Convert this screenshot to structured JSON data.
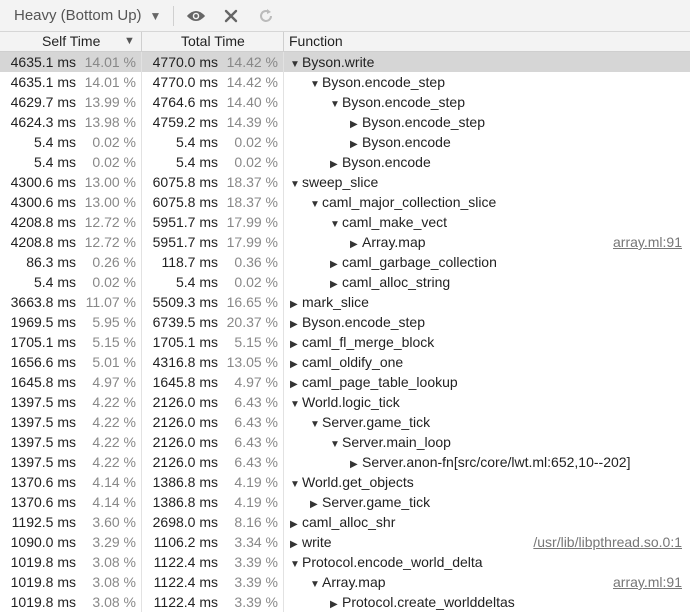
{
  "toolbar": {
    "view_label": "Heavy (Bottom Up)"
  },
  "columns": {
    "self": "Self Time",
    "total": "Total Time",
    "function": "Function"
  },
  "rows": [
    {
      "self_ms": "4635.1 ms",
      "self_pct": "14.01 %",
      "total_ms": "4770.0 ms",
      "total_pct": "14.42 %",
      "depth": 0,
      "arrow": "expanded",
      "name": "Byson.write",
      "src": "",
      "selected": true
    },
    {
      "self_ms": "4635.1 ms",
      "self_pct": "14.01 %",
      "total_ms": "4770.0 ms",
      "total_pct": "14.42 %",
      "depth": 1,
      "arrow": "expanded",
      "name": "Byson.encode_step",
      "src": ""
    },
    {
      "self_ms": "4629.7 ms",
      "self_pct": "13.99 %",
      "total_ms": "4764.6 ms",
      "total_pct": "14.40 %",
      "depth": 2,
      "arrow": "expanded",
      "name": "Byson.encode_step",
      "src": ""
    },
    {
      "self_ms": "4624.3 ms",
      "self_pct": "13.98 %",
      "total_ms": "4759.2 ms",
      "total_pct": "14.39 %",
      "depth": 3,
      "arrow": "collapsed",
      "name": "Byson.encode_step",
      "src": ""
    },
    {
      "self_ms": "5.4 ms",
      "self_pct": "0.02 %",
      "total_ms": "5.4 ms",
      "total_pct": "0.02 %",
      "depth": 3,
      "arrow": "collapsed",
      "name": "Byson.encode",
      "src": ""
    },
    {
      "self_ms": "5.4 ms",
      "self_pct": "0.02 %",
      "total_ms": "5.4 ms",
      "total_pct": "0.02 %",
      "depth": 2,
      "arrow": "collapsed",
      "name": "Byson.encode",
      "src": ""
    },
    {
      "self_ms": "4300.6 ms",
      "self_pct": "13.00 %",
      "total_ms": "6075.8 ms",
      "total_pct": "18.37 %",
      "depth": 0,
      "arrow": "expanded",
      "name": "sweep_slice",
      "src": ""
    },
    {
      "self_ms": "4300.6 ms",
      "self_pct": "13.00 %",
      "total_ms": "6075.8 ms",
      "total_pct": "18.37 %",
      "depth": 1,
      "arrow": "expanded",
      "name": "caml_major_collection_slice",
      "src": ""
    },
    {
      "self_ms": "4208.8 ms",
      "self_pct": "12.72 %",
      "total_ms": "5951.7 ms",
      "total_pct": "17.99 %",
      "depth": 2,
      "arrow": "expanded",
      "name": "caml_make_vect",
      "src": ""
    },
    {
      "self_ms": "4208.8 ms",
      "self_pct": "12.72 %",
      "total_ms": "5951.7 ms",
      "total_pct": "17.99 %",
      "depth": 3,
      "arrow": "collapsed",
      "name": "Array.map",
      "src": "array.ml:91"
    },
    {
      "self_ms": "86.3 ms",
      "self_pct": "0.26 %",
      "total_ms": "118.7 ms",
      "total_pct": "0.36 %",
      "depth": 2,
      "arrow": "collapsed",
      "name": "caml_garbage_collection",
      "src": ""
    },
    {
      "self_ms": "5.4 ms",
      "self_pct": "0.02 %",
      "total_ms": "5.4 ms",
      "total_pct": "0.02 %",
      "depth": 2,
      "arrow": "collapsed",
      "name": "caml_alloc_string",
      "src": ""
    },
    {
      "self_ms": "3663.8 ms",
      "self_pct": "11.07 %",
      "total_ms": "5509.3 ms",
      "total_pct": "16.65 %",
      "depth": 0,
      "arrow": "collapsed",
      "name": "mark_slice",
      "src": ""
    },
    {
      "self_ms": "1969.5 ms",
      "self_pct": "5.95 %",
      "total_ms": "6739.5 ms",
      "total_pct": "20.37 %",
      "depth": 0,
      "arrow": "collapsed",
      "name": "Byson.encode_step",
      "src": ""
    },
    {
      "self_ms": "1705.1 ms",
      "self_pct": "5.15 %",
      "total_ms": "1705.1 ms",
      "total_pct": "5.15 %",
      "depth": 0,
      "arrow": "collapsed",
      "name": "caml_fl_merge_block",
      "src": ""
    },
    {
      "self_ms": "1656.6 ms",
      "self_pct": "5.01 %",
      "total_ms": "4316.8 ms",
      "total_pct": "13.05 %",
      "depth": 0,
      "arrow": "collapsed",
      "name": "caml_oldify_one",
      "src": ""
    },
    {
      "self_ms": "1645.8 ms",
      "self_pct": "4.97 %",
      "total_ms": "1645.8 ms",
      "total_pct": "4.97 %",
      "depth": 0,
      "arrow": "collapsed",
      "name": "caml_page_table_lookup",
      "src": ""
    },
    {
      "self_ms": "1397.5 ms",
      "self_pct": "4.22 %",
      "total_ms": "2126.0 ms",
      "total_pct": "6.43 %",
      "depth": 0,
      "arrow": "expanded",
      "name": "World.logic_tick",
      "src": ""
    },
    {
      "self_ms": "1397.5 ms",
      "self_pct": "4.22 %",
      "total_ms": "2126.0 ms",
      "total_pct": "6.43 %",
      "depth": 1,
      "arrow": "expanded",
      "name": "Server.game_tick",
      "src": ""
    },
    {
      "self_ms": "1397.5 ms",
      "self_pct": "4.22 %",
      "total_ms": "2126.0 ms",
      "total_pct": "6.43 %",
      "depth": 2,
      "arrow": "expanded",
      "name": "Server.main_loop",
      "src": ""
    },
    {
      "self_ms": "1397.5 ms",
      "self_pct": "4.22 %",
      "total_ms": "2126.0 ms",
      "total_pct": "6.43 %",
      "depth": 3,
      "arrow": "collapsed",
      "name": "Server.anon-fn[src/core/lwt.ml:652,10--202]",
      "src": ""
    },
    {
      "self_ms": "1370.6 ms",
      "self_pct": "4.14 %",
      "total_ms": "1386.8 ms",
      "total_pct": "4.19 %",
      "depth": 0,
      "arrow": "expanded",
      "name": "World.get_objects",
      "src": ""
    },
    {
      "self_ms": "1370.6 ms",
      "self_pct": "4.14 %",
      "total_ms": "1386.8 ms",
      "total_pct": "4.19 %",
      "depth": 1,
      "arrow": "collapsed",
      "name": "Server.game_tick",
      "src": ""
    },
    {
      "self_ms": "1192.5 ms",
      "self_pct": "3.60 %",
      "total_ms": "2698.0 ms",
      "total_pct": "8.16 %",
      "depth": 0,
      "arrow": "collapsed",
      "name": "caml_alloc_shr",
      "src": ""
    },
    {
      "self_ms": "1090.0 ms",
      "self_pct": "3.29 %",
      "total_ms": "1106.2 ms",
      "total_pct": "3.34 %",
      "depth": 0,
      "arrow": "collapsed",
      "name": "write",
      "src": "/usr/lib/libpthread.so.0:1"
    },
    {
      "self_ms": "1019.8 ms",
      "self_pct": "3.08 %",
      "total_ms": "1122.4 ms",
      "total_pct": "3.39 %",
      "depth": 0,
      "arrow": "expanded",
      "name": "Protocol.encode_world_delta",
      "src": ""
    },
    {
      "self_ms": "1019.8 ms",
      "self_pct": "3.08 %",
      "total_ms": "1122.4 ms",
      "total_pct": "3.39 %",
      "depth": 1,
      "arrow": "expanded",
      "name": "Array.map",
      "src": "array.ml:91"
    },
    {
      "self_ms": "1019.8 ms",
      "self_pct": "3.08 %",
      "total_ms": "1122.4 ms",
      "total_pct": "3.39 %",
      "depth": 2,
      "arrow": "collapsed",
      "name": "Protocol.create_worlddeltas",
      "src": ""
    }
  ]
}
